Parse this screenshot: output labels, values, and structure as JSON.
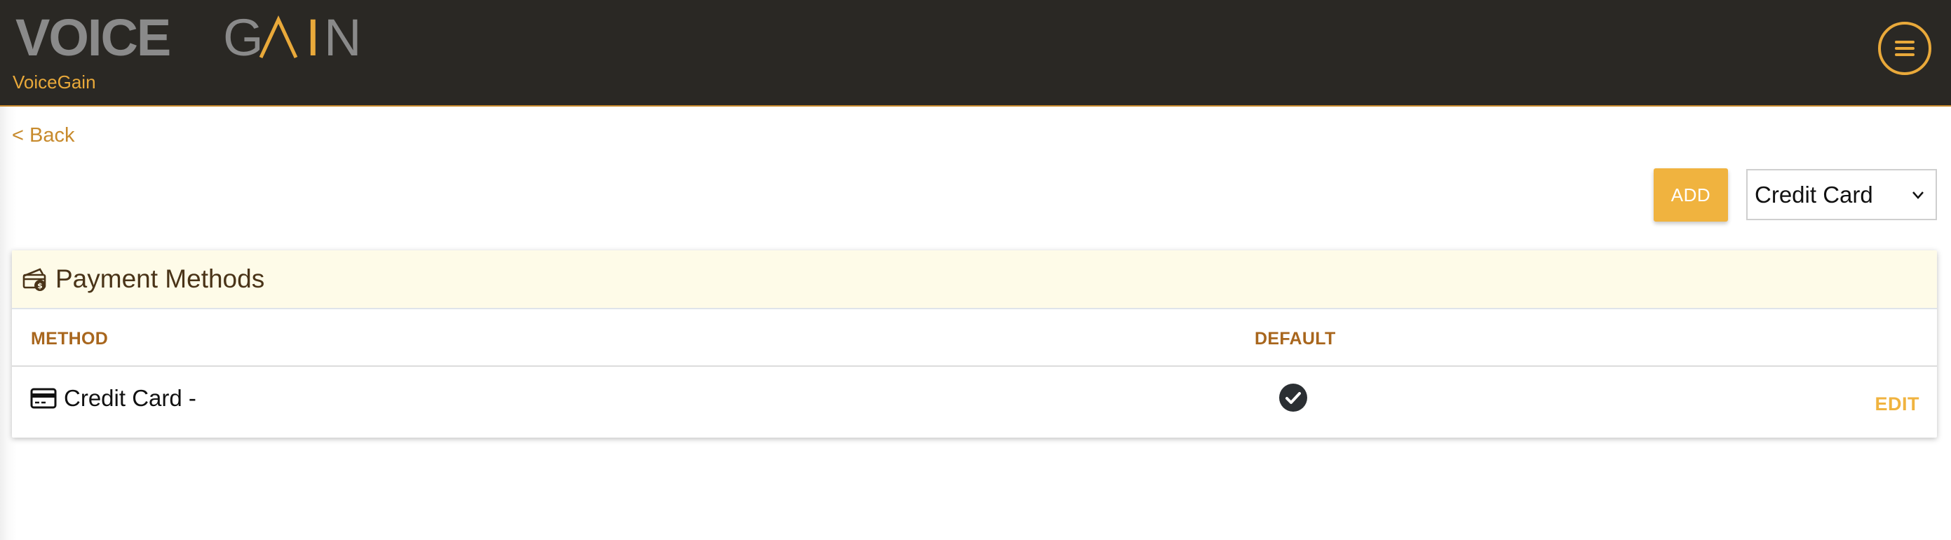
{
  "header": {
    "logo": {
      "part1": "VOICE",
      "part2_g": "G",
      "part2_a": "A",
      "part2_i": "I",
      "part2_n": "N"
    },
    "org_name": "VoiceGain",
    "menu_icon": "hamburger-menu-icon"
  },
  "nav": {
    "back_label": "< Back"
  },
  "toolbar": {
    "add_label": "ADD",
    "type_select": {
      "selected": "Credit Card",
      "options": [
        "Credit Card"
      ]
    }
  },
  "payment_methods": {
    "title": "Payment Methods",
    "title_icon": "wallet-icon",
    "columns": {
      "method": "METHOD",
      "default": "DEFAULT"
    },
    "rows": [
      {
        "method": "Credit Card -",
        "method_icon": "credit-card-icon",
        "is_default": true,
        "action": "EDIT"
      }
    ]
  },
  "colors": {
    "header_bg": "#2a2824",
    "accent": "#f0b33f",
    "accent_text": "#c78a2c",
    "header_text": "#4a3418",
    "panel_header_bg": "#fefbe8"
  }
}
